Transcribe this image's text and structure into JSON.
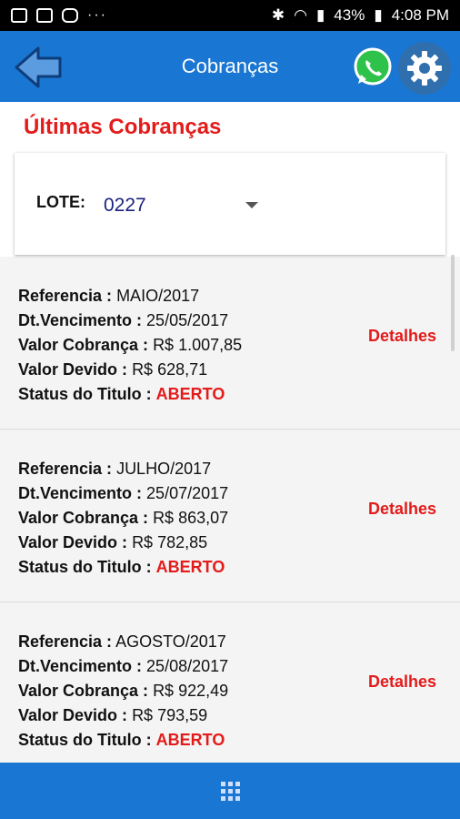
{
  "statusbar": {
    "battery": "43%",
    "time": "4:08 PM",
    "dots": "···"
  },
  "appbar": {
    "title": "Cobranças"
  },
  "section": {
    "title": "Últimas Cobranças"
  },
  "filter": {
    "label": "LOTE:",
    "value": "0227"
  },
  "labels": {
    "referencia": "Referencia :",
    "vencimento": "Dt.Vencimento  :",
    "valor_cobranca": "Valor Cobrança :",
    "valor_devido": "Valor Devido :",
    "status": "Status do Titulo :",
    "detalhes": "Detalhes"
  },
  "items": [
    {
      "referencia": "MAIO/2017",
      "vencimento": "25/05/2017",
      "valor_cobranca": "R$ 1.007,85",
      "valor_devido": "R$ 628,71",
      "status": "ABERTO"
    },
    {
      "referencia": "JULHO/2017",
      "vencimento": "25/07/2017",
      "valor_cobranca": "R$ 863,07",
      "valor_devido": "R$ 782,85",
      "status": "ABERTO"
    },
    {
      "referencia": "AGOSTO/2017",
      "vencimento": "25/08/2017",
      "valor_cobranca": "R$ 922,49",
      "valor_devido": "R$ 793,59",
      "status": "ABERTO"
    }
  ],
  "colors": {
    "primary": "#1976d2",
    "accent": "#e31b1b",
    "lote_value": "#1a237e"
  },
  "icons": {
    "back": "arrow-left-icon",
    "whatsapp": "whatsapp-icon",
    "settings": "gear-icon",
    "bottom_menu": "apps-grid-icon"
  }
}
